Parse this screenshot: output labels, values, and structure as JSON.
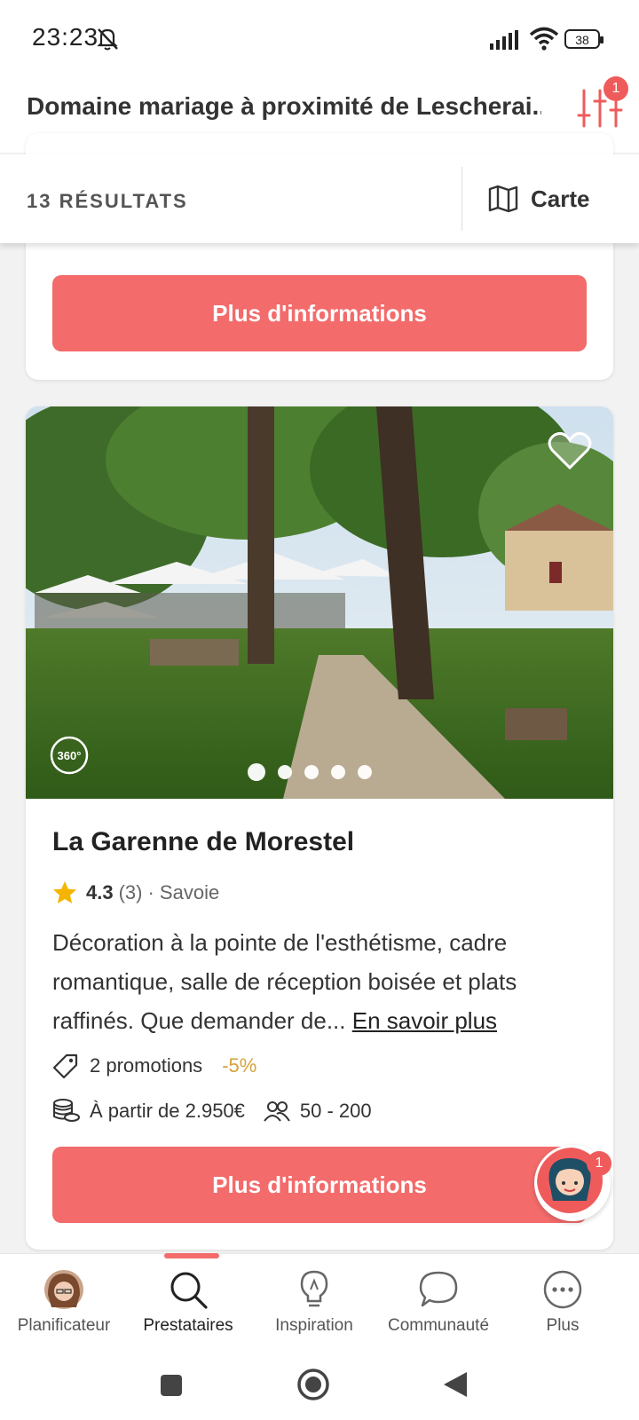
{
  "status_bar": {
    "time": "23:23",
    "battery": "38"
  },
  "header": {
    "title": "Domaine mariage à proximité de Lescherai...",
    "filter_badge": "1"
  },
  "results_bar": {
    "count_label": "13 RÉSULTATS",
    "map_label": "Carte"
  },
  "card_prev": {
    "button_label": "Plus d'informations"
  },
  "card": {
    "name": "La Garenne de Morestel",
    "rating": "4.3",
    "reviews": "(3)",
    "location": "· Savoie",
    "description": "Décoration à la pointe de l'esthétisme, cadre romantique, salle de réception boisée et plats raffinés. Que demander de...",
    "more_link": "En savoir plus",
    "promotions": "2 promotions",
    "discount": "-5%",
    "price": "À partir de 2.950€",
    "capacity": "50 - 200",
    "button_label": "Plus d'informations",
    "photo_count": 5,
    "active_photo": 1
  },
  "chat": {
    "badge": "1"
  },
  "bottom_nav": [
    {
      "label": "Planificateur",
      "icon": "avatar"
    },
    {
      "label": "Prestataires",
      "icon": "search-icon"
    },
    {
      "label": "Inspiration",
      "icon": "lightbulb-icon"
    },
    {
      "label": "Communauté",
      "icon": "chat-bubble-icon"
    },
    {
      "label": "Plus",
      "icon": "more-icon"
    }
  ],
  "colors": {
    "accent": "#f36b6b",
    "badge": "#ef5b5b",
    "discount": "#d6a23a"
  }
}
